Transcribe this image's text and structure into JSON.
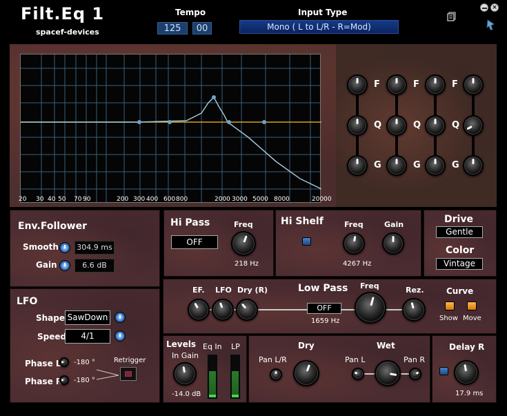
{
  "app": {
    "title": "Filt.Eq  1",
    "vendor": "spacef-devices"
  },
  "tempo": {
    "label": "Tempo",
    "bpm": "125",
    "fraction": "00"
  },
  "input_type": {
    "label": "Input Type",
    "value": "Mono ( L to L/R - R=Mod)"
  },
  "graph": {
    "freq_labels": [
      "20",
      "30",
      "40",
      "50",
      "70",
      "90",
      "200",
      "300",
      "400",
      "600",
      "800",
      "2000",
      "3000",
      "5000",
      "8000",
      "20000"
    ]
  },
  "eq_bands": {
    "f_label": "F",
    "q_label": "Q",
    "g_label": "G"
  },
  "env_follower": {
    "title": "Env.Follower",
    "smooth_label": "Smooth",
    "smooth_value": "304.9 ms",
    "gain_label": "Gain",
    "gain_value": "6.6 dB"
  },
  "hi_pass": {
    "title": "Hi Pass",
    "state": "OFF",
    "freq_label": "Freq",
    "freq_value": "218 Hz"
  },
  "hi_shelf": {
    "title": "Hi Shelf",
    "freq_label": "Freq",
    "freq_value": "4267 Hz",
    "gain_label": "Gain"
  },
  "drive": {
    "title": "Drive",
    "value": "Gentle"
  },
  "color": {
    "title": "Color",
    "value": "Vintage"
  },
  "lfo": {
    "title": "LFO",
    "shape_label": "Shape",
    "shape_value": "SawDown",
    "speed_label": "Speed",
    "speed_value": "4/1",
    "phase_l_label": "Phase L",
    "phase_l_value": "-180 °",
    "phase_r_label": "Phase R",
    "phase_r_value": "-180 °",
    "retrigger_label": "Retrigger"
  },
  "low_pass": {
    "ef_label": "EF.",
    "lfo_label": "LFO",
    "dry_r_label": "Dry (R)",
    "title": "Low Pass",
    "state": "OFF",
    "freq_label": "Freq",
    "freq_value": "1659 Hz",
    "rez_label": "Rez.",
    "curve_label": "Curve",
    "show_label": "Show",
    "move_label": "Move"
  },
  "levels": {
    "title": "Levels",
    "in_gain_label": "In Gain",
    "in_gain_value": "-14.0 dB",
    "eq_in_label": "Eq In",
    "lp_label": "LP"
  },
  "dry": {
    "title": "Dry",
    "pan_label": "Pan L/R"
  },
  "wet": {
    "title": "Wet",
    "pan_l_label": "Pan L",
    "pan_r_label": "Pan R"
  },
  "delay": {
    "title": "Delay R",
    "value": "17.9 ms"
  }
}
